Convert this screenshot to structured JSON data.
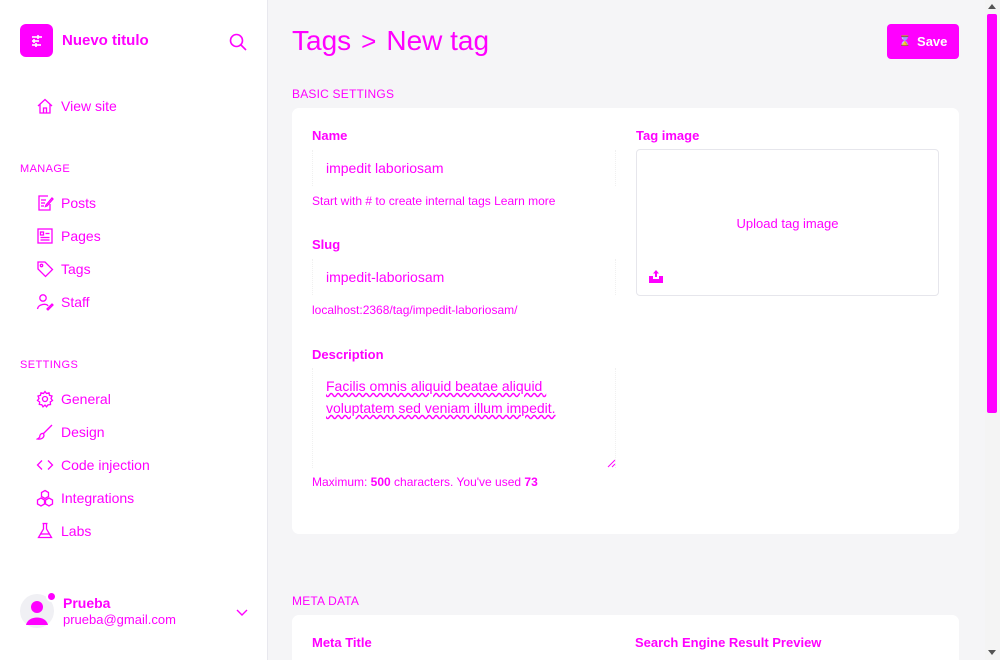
{
  "sidebar": {
    "brand_title": "Nuevo titulo",
    "view_site": "View site",
    "manage_label": "MANAGE",
    "manage_items": [
      "Posts",
      "Pages",
      "Tags",
      "Staff"
    ],
    "settings_label": "SETTINGS",
    "settings_items": [
      "General",
      "Design",
      "Code injection",
      "Integrations",
      "Labs"
    ],
    "user": {
      "name": "Prueba",
      "email": "prueba@gmail.com"
    }
  },
  "header": {
    "breadcrumb_parent": "Tags",
    "breadcrumb_separator": ">",
    "breadcrumb_current": "New tag",
    "save_label": "Save"
  },
  "basic": {
    "section_label": "BASIC SETTINGS",
    "name_label": "Name",
    "name_value": "impedit laboriosam",
    "name_hint": "Start with # to create internal tags Learn more",
    "slug_label": "Slug",
    "slug_value": "impedit-laboriosam",
    "slug_url": "localhost:2368/tag/impedit-laboriosam/",
    "description_label": "Description",
    "description_value": "Facilis omnis aliquid beatae aliquid voluptatem sed veniam illum impedit.",
    "char_hint_prefix": "Maximum: ",
    "char_max": "500",
    "char_hint_mid": " characters. You've used ",
    "char_used": "73",
    "tag_image_label": "Tag image",
    "upload_label": "Upload tag image"
  },
  "meta": {
    "section_label": "META DATA",
    "meta_title_label": "Meta Title",
    "serp_label": "Search Engine Result Preview"
  },
  "colors": {
    "accent": "#ff00ff",
    "page_bg": "#f5f5f7",
    "card_bg": "#ffffff"
  },
  "icons": {
    "brand": "list-icon",
    "search": "search-icon",
    "view_site": "home-icon",
    "manage": [
      "posts-icon",
      "pages-icon",
      "tag-icon",
      "staff-icon"
    ],
    "settings": [
      "gear-icon",
      "brush-icon",
      "code-icon",
      "integrations-icon",
      "flask-icon"
    ],
    "upload": "upload-icon",
    "user_menu": "chevron-down-icon"
  },
  "scroll_position": 0
}
